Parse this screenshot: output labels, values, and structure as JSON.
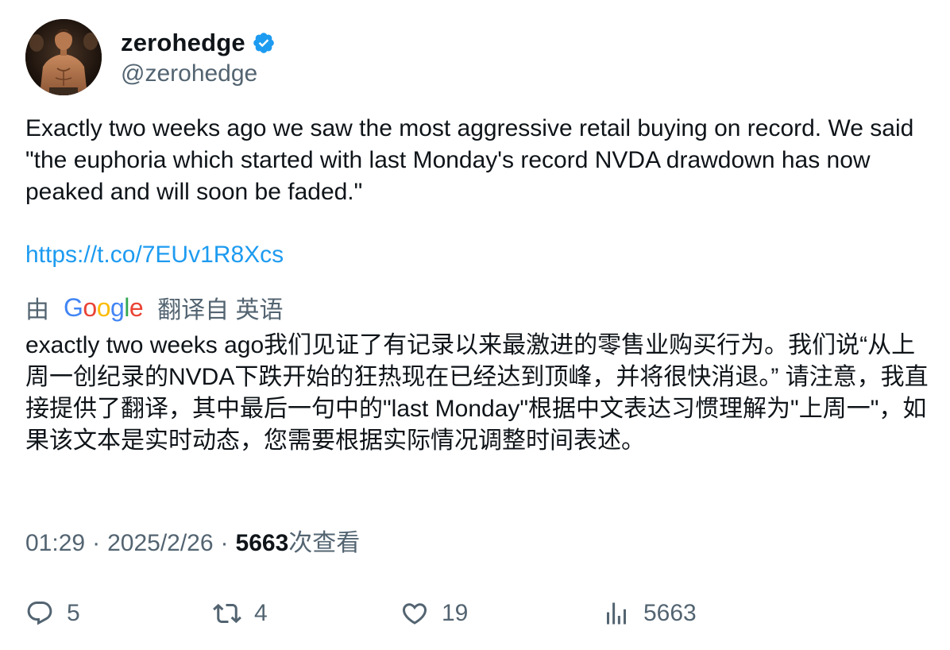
{
  "author": {
    "display_name": "zerohedge",
    "handle": "@zerohedge",
    "verified_color": "#1d9bf0"
  },
  "tweet": {
    "text": "Exactly two weeks ago we saw the most aggressive retail buying on record. We said \"the euphoria which started with last Monday's record NVDA drawdown has now peaked and will soon be faded.\"",
    "link": "https://t.co/7EUv1R8Xcs"
  },
  "translation": {
    "prefix": "由",
    "provider": "Google",
    "suffix": "翻译自 英语",
    "text": "exactly two weeks ago我们见证了有记录以来最激进的零售业购买行为。我们说“从上周一创纪录的NVDA下跌开始的狂热现在已经达到顶峰，并将很快消退。” 请注意，我直接提供了翻译，其中最后一句中的\"last Monday\"根据中文表达习惯理解为\"上周一\"，如果该文本是实时动态，您需要根据实际情况调整时间表述。"
  },
  "meta": {
    "time": "01:29",
    "separator": "·",
    "date": "2025/2/26",
    "views_count": "5663",
    "views_label": "次查看"
  },
  "actions": {
    "replies": "5",
    "retweets": "4",
    "likes": "19",
    "views": "5663"
  },
  "icons": {
    "reply": "reply-icon",
    "retweet": "retweet-icon",
    "like": "heart-icon",
    "views": "views-chart-icon",
    "verified": "verified-badge-icon"
  },
  "colors": {
    "text_primary": "#0f1419",
    "text_secondary": "#536471",
    "link": "#1d9bf0"
  }
}
